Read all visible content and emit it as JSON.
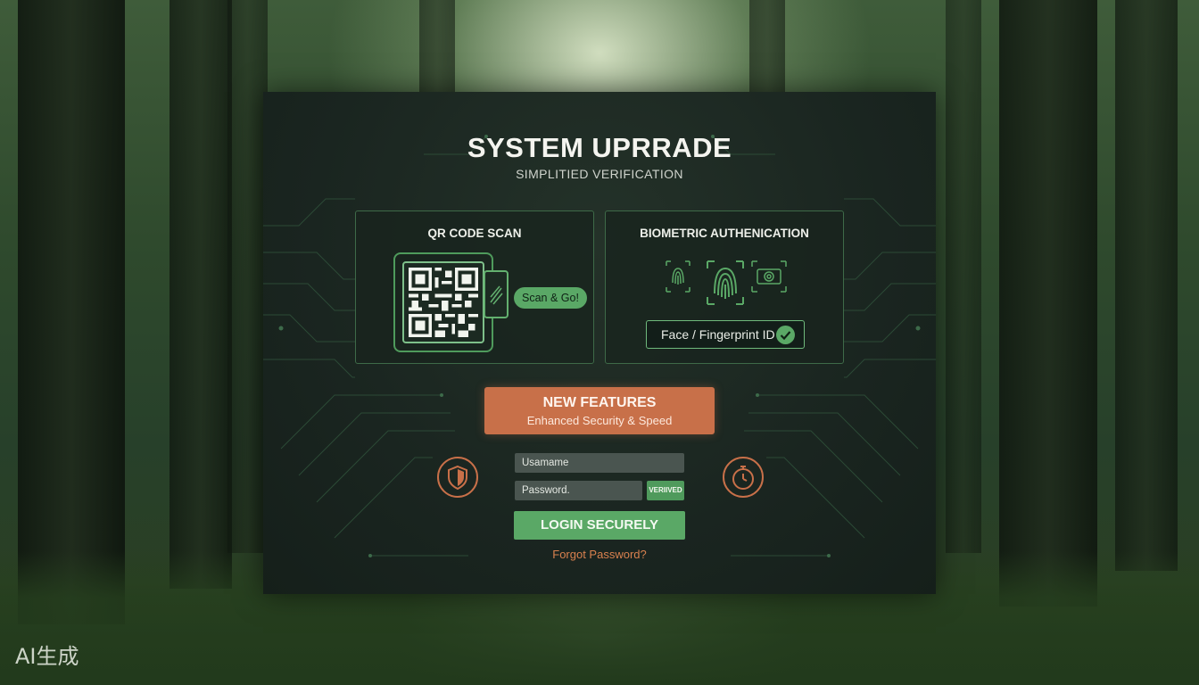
{
  "watermark": "AI生成",
  "panel": {
    "title": "SYSTEM UPRRADE",
    "subtitle": "SIMPLITIED VERIFICATION"
  },
  "qr_card": {
    "title": "QR CODE SCAN",
    "pill_label": "Scan & Go!"
  },
  "bio_card": {
    "title": "BIOMETRIC AUTHENICATION",
    "button_label": "Face / Fingerprint ID"
  },
  "features": {
    "heading": "NEW FEATURES",
    "subheading": "Enhanced Security & Speed"
  },
  "form": {
    "username_placeholder": "Usamame",
    "password_placeholder": "Password.",
    "verified_badge": "VERIIVED",
    "login_label": "LOGIN SECURELY",
    "forgot_label": "Forgot Password?"
  },
  "colors": {
    "accent_green": "#5aa866",
    "accent_orange": "#c87049",
    "panel_bg": "#1a2520"
  },
  "icons": {
    "left": "shield-icon",
    "right": "stopwatch-icon"
  }
}
